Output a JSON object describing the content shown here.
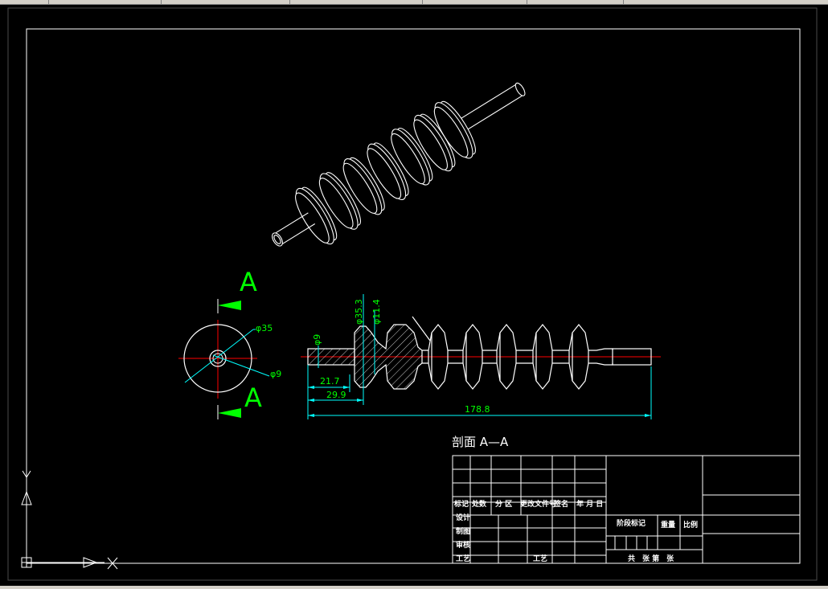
{
  "section": {
    "label_a": "A",
    "title": "剖面 A—A"
  },
  "dims": {
    "d_outer": "φ35",
    "d_hole": "φ9",
    "shaft_d": "φ9",
    "flange_d": "φ35.3",
    "groove_d": "φ11.4",
    "len_1": "21.7",
    "len_2": "29.9",
    "len_total": "178.8"
  },
  "title_block": {
    "mark": "标记",
    "count": "处数",
    "zone": "分 区",
    "doc_no": "更改文件号",
    "sign": "签名",
    "date": "年 月 日",
    "design": "设计",
    "drafting": "制图",
    "review": "审核",
    "process": "工艺",
    "process2": "工艺",
    "stage": "阶段标记",
    "weight": "重量",
    "scale": "比例",
    "sheets": "共　张 第　张"
  },
  "colors": {
    "line": "#ffffff",
    "center": "#ff0000",
    "dim": "#00ffff",
    "dimtext": "#00ff00",
    "arrow": "#00ff00",
    "frame": "#b4d2dc"
  }
}
